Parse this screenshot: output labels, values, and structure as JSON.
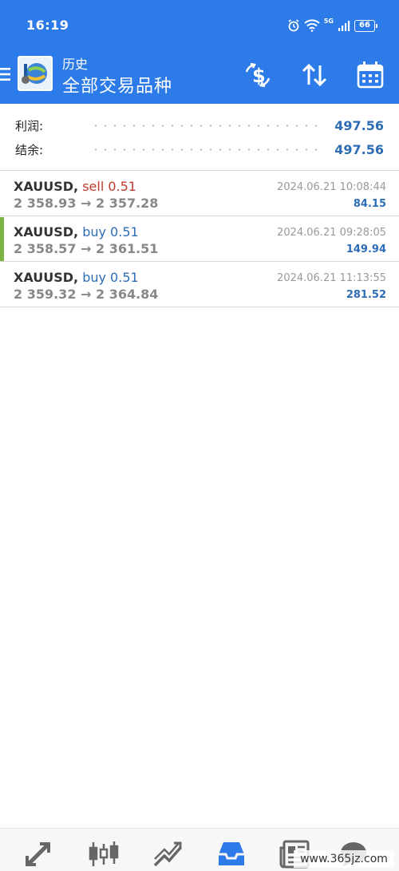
{
  "status_bar": {
    "time": "16:19",
    "network": "5G",
    "battery": "66"
  },
  "toolbar": {
    "subtitle": "历史",
    "title": "全部交易品种"
  },
  "summary": {
    "profit_label": "利润:",
    "profit_value": "497.56",
    "balance_label": "结余:",
    "balance_value": "497.56"
  },
  "trades": [
    {
      "symbol": "XAUUSD,",
      "type": "sell",
      "volume": "0.51",
      "prices": "2 358.93 → 2 357.28",
      "time": "2024.06.21 10:08:44",
      "profit": "84.15"
    },
    {
      "symbol": "XAUUSD,",
      "type": "buy",
      "volume": "0.51",
      "prices": "2 358.57 → 2 361.51",
      "time": "2024.06.21 09:28:05",
      "profit": "149.94"
    },
    {
      "symbol": "XAUUSD,",
      "type": "buy",
      "volume": "0.51",
      "prices": "2 359.32 → 2 364.84",
      "time": "2024.06.21 11:13:55",
      "profit": "281.52"
    }
  ],
  "icons": {
    "menu": "menu-icon",
    "currency": "currency-exchange-icon",
    "sort": "sort-icon",
    "calendar": "calendar-icon",
    "nav": [
      "quotes-icon",
      "chart-icon",
      "trade-icon",
      "history-icon",
      "news-icon",
      "messages-icon"
    ]
  },
  "watermark": "www.365jz.com",
  "colors": {
    "header": "#2d7be8",
    "profit": "#2d6db6",
    "sell": "#c0392b",
    "buy": "#2d6db6",
    "active_accent": "#7cb342"
  }
}
